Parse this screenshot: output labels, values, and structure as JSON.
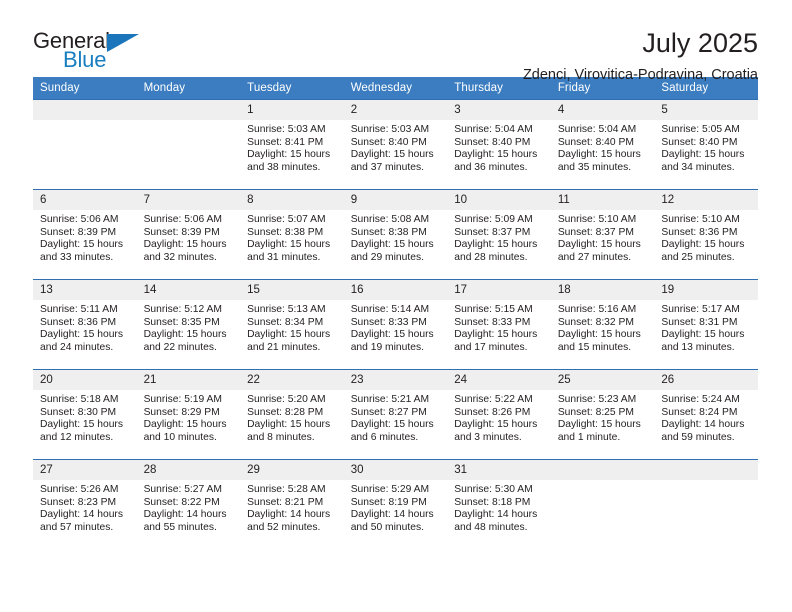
{
  "brand": {
    "word1": "General",
    "word2": "Blue",
    "triangle_color": "#1b75bb",
    "text_color": "#231f20"
  },
  "header": {
    "title": "July 2025",
    "subtitle": "Zdenci, Virovitica-Podravina, Croatia",
    "accent_color": "#3b7dc0",
    "daynum_bg": "#efefef"
  },
  "calendar": {
    "weekday_headers": [
      "Sunday",
      "Monday",
      "Tuesday",
      "Wednesday",
      "Thursday",
      "Friday",
      "Saturday"
    ],
    "weeks": [
      [
        {
          "day": "",
          "lines": []
        },
        {
          "day": "",
          "lines": []
        },
        {
          "day": "1",
          "lines": [
            "Sunrise: 5:03 AM",
            "Sunset: 8:41 PM",
            "Daylight: 15 hours and 38 minutes."
          ]
        },
        {
          "day": "2",
          "lines": [
            "Sunrise: 5:03 AM",
            "Sunset: 8:40 PM",
            "Daylight: 15 hours and 37 minutes."
          ]
        },
        {
          "day": "3",
          "lines": [
            "Sunrise: 5:04 AM",
            "Sunset: 8:40 PM",
            "Daylight: 15 hours and 36 minutes."
          ]
        },
        {
          "day": "4",
          "lines": [
            "Sunrise: 5:04 AM",
            "Sunset: 8:40 PM",
            "Daylight: 15 hours and 35 minutes."
          ]
        },
        {
          "day": "5",
          "lines": [
            "Sunrise: 5:05 AM",
            "Sunset: 8:40 PM",
            "Daylight: 15 hours and 34 minutes."
          ]
        }
      ],
      [
        {
          "day": "6",
          "lines": [
            "Sunrise: 5:06 AM",
            "Sunset: 8:39 PM",
            "Daylight: 15 hours and 33 minutes."
          ]
        },
        {
          "day": "7",
          "lines": [
            "Sunrise: 5:06 AM",
            "Sunset: 8:39 PM",
            "Daylight: 15 hours and 32 minutes."
          ]
        },
        {
          "day": "8",
          "lines": [
            "Sunrise: 5:07 AM",
            "Sunset: 8:38 PM",
            "Daylight: 15 hours and 31 minutes."
          ]
        },
        {
          "day": "9",
          "lines": [
            "Sunrise: 5:08 AM",
            "Sunset: 8:38 PM",
            "Daylight: 15 hours and 29 minutes."
          ]
        },
        {
          "day": "10",
          "lines": [
            "Sunrise: 5:09 AM",
            "Sunset: 8:37 PM",
            "Daylight: 15 hours and 28 minutes."
          ]
        },
        {
          "day": "11",
          "lines": [
            "Sunrise: 5:10 AM",
            "Sunset: 8:37 PM",
            "Daylight: 15 hours and 27 minutes."
          ]
        },
        {
          "day": "12",
          "lines": [
            "Sunrise: 5:10 AM",
            "Sunset: 8:36 PM",
            "Daylight: 15 hours and 25 minutes."
          ]
        }
      ],
      [
        {
          "day": "13",
          "lines": [
            "Sunrise: 5:11 AM",
            "Sunset: 8:36 PM",
            "Daylight: 15 hours and 24 minutes."
          ]
        },
        {
          "day": "14",
          "lines": [
            "Sunrise: 5:12 AM",
            "Sunset: 8:35 PM",
            "Daylight: 15 hours and 22 minutes."
          ]
        },
        {
          "day": "15",
          "lines": [
            "Sunrise: 5:13 AM",
            "Sunset: 8:34 PM",
            "Daylight: 15 hours and 21 minutes."
          ]
        },
        {
          "day": "16",
          "lines": [
            "Sunrise: 5:14 AM",
            "Sunset: 8:33 PM",
            "Daylight: 15 hours and 19 minutes."
          ]
        },
        {
          "day": "17",
          "lines": [
            "Sunrise: 5:15 AM",
            "Sunset: 8:33 PM",
            "Daylight: 15 hours and 17 minutes."
          ]
        },
        {
          "day": "18",
          "lines": [
            "Sunrise: 5:16 AM",
            "Sunset: 8:32 PM",
            "Daylight: 15 hours and 15 minutes."
          ]
        },
        {
          "day": "19",
          "lines": [
            "Sunrise: 5:17 AM",
            "Sunset: 8:31 PM",
            "Daylight: 15 hours and 13 minutes."
          ]
        }
      ],
      [
        {
          "day": "20",
          "lines": [
            "Sunrise: 5:18 AM",
            "Sunset: 8:30 PM",
            "Daylight: 15 hours and 12 minutes."
          ]
        },
        {
          "day": "21",
          "lines": [
            "Sunrise: 5:19 AM",
            "Sunset: 8:29 PM",
            "Daylight: 15 hours and 10 minutes."
          ]
        },
        {
          "day": "22",
          "lines": [
            "Sunrise: 5:20 AM",
            "Sunset: 8:28 PM",
            "Daylight: 15 hours and 8 minutes."
          ]
        },
        {
          "day": "23",
          "lines": [
            "Sunrise: 5:21 AM",
            "Sunset: 8:27 PM",
            "Daylight: 15 hours and 6 minutes."
          ]
        },
        {
          "day": "24",
          "lines": [
            "Sunrise: 5:22 AM",
            "Sunset: 8:26 PM",
            "Daylight: 15 hours and 3 minutes."
          ]
        },
        {
          "day": "25",
          "lines": [
            "Sunrise: 5:23 AM",
            "Sunset: 8:25 PM",
            "Daylight: 15 hours and 1 minute."
          ]
        },
        {
          "day": "26",
          "lines": [
            "Sunrise: 5:24 AM",
            "Sunset: 8:24 PM",
            "Daylight: 14 hours and 59 minutes."
          ]
        }
      ],
      [
        {
          "day": "27",
          "lines": [
            "Sunrise: 5:26 AM",
            "Sunset: 8:23 PM",
            "Daylight: 14 hours and 57 minutes."
          ]
        },
        {
          "day": "28",
          "lines": [
            "Sunrise: 5:27 AM",
            "Sunset: 8:22 PM",
            "Daylight: 14 hours and 55 minutes."
          ]
        },
        {
          "day": "29",
          "lines": [
            "Sunrise: 5:28 AM",
            "Sunset: 8:21 PM",
            "Daylight: 14 hours and 52 minutes."
          ]
        },
        {
          "day": "30",
          "lines": [
            "Sunrise: 5:29 AM",
            "Sunset: 8:19 PM",
            "Daylight: 14 hours and 50 minutes."
          ]
        },
        {
          "day": "31",
          "lines": [
            "Sunrise: 5:30 AM",
            "Sunset: 8:18 PM",
            "Daylight: 14 hours and 48 minutes."
          ]
        },
        {
          "day": "",
          "lines": []
        },
        {
          "day": "",
          "lines": []
        }
      ]
    ]
  }
}
